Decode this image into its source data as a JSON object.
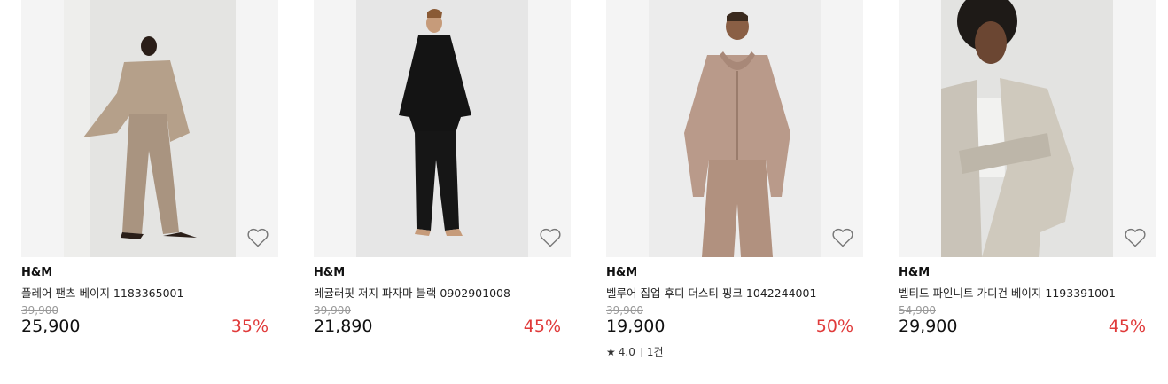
{
  "products": [
    {
      "brand": "H&M",
      "name": "플레어 팬츠 베이지 1183365001",
      "original_price": "39,900",
      "price": "25,900",
      "discount": "35%"
    },
    {
      "brand": "H&M",
      "name": "레귤러핏 저지 파자마 블랙 0902901008",
      "original_price": "39,900",
      "price": "21,890",
      "discount": "45%"
    },
    {
      "brand": "H&M",
      "name": "벨루어 집업 후디 더스티 핑크 1042244001",
      "original_price": "39,900",
      "price": "19,900",
      "discount": "50%",
      "rating": "4.0",
      "review_count": "1건"
    },
    {
      "brand": "H&M",
      "name": "벨티드 파인니트 가디건 베이지 1193391001",
      "original_price": "54,900",
      "price": "29,900",
      "discount": "45%"
    }
  ],
  "icons": {
    "wishlist": "heart-outline-icon",
    "rating": "star-icon"
  },
  "colors": {
    "discount": "#e03a3a",
    "original_price": "#999999",
    "image_bg": "#f4f4f4"
  }
}
